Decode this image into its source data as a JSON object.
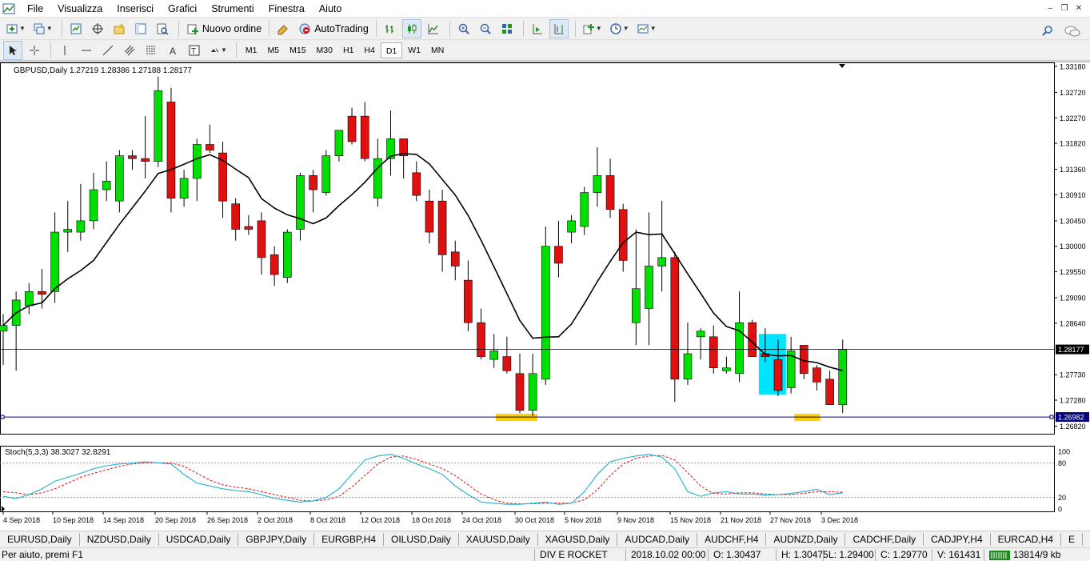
{
  "menu": [
    "File",
    "Visualizza",
    "Inserisci",
    "Grafici",
    "Strumenti",
    "Finestra",
    "Aiuto"
  ],
  "toolbar": {
    "new_order_label": "Nuovo ordine",
    "autotrading_label": "AutoTrading",
    "timeframes": [
      "M1",
      "M5",
      "M15",
      "M30",
      "H1",
      "H4",
      "D1",
      "W1",
      "MN"
    ],
    "active_timeframe": "D1"
  },
  "chart": {
    "header": "GBPUSD,Daily  1.27219 1.28386 1.27188 1.28177",
    "indicator_header": "Stoch(5,3,3) 38.3027 32.8291",
    "current_price": "1.28177",
    "marker_price": "1.26982",
    "colors": {
      "bull": "#00e000",
      "bear": "#e01010",
      "ma": "#000000",
      "stoch_main": "#20b0d0",
      "stoch_signal": "#e01010",
      "highlight_cyan": "#00e5ff",
      "highlight_yellow": "#ffd000",
      "price_label_bg": "#000080"
    }
  },
  "chart_data": {
    "type": "candlestick",
    "symbol": "GBPUSD",
    "timeframe": "Daily",
    "y_ticks": [
      "1.33180",
      "1.32720",
      "1.32270",
      "1.31820",
      "1.31360",
      "1.30910",
      "1.30450",
      "1.30000",
      "1.29550",
      "1.29090",
      "1.28640",
      "1.27730",
      "1.27280",
      "1.26820"
    ],
    "ylim": [
      1.267,
      1.3325
    ],
    "x_labels": [
      "4 Sep 2018",
      "10 Sep 2018",
      "14 Sep 2018",
      "20 Sep 2018",
      "26 Sep 2018",
      "2 Oct 2018",
      "8 Oct 2018",
      "12 Oct 2018",
      "18 Oct 2018",
      "24 Oct 2018",
      "30 Oct 2018",
      "5 Nov 2018",
      "9 Nov 2018",
      "15 Nov 2018",
      "21 Nov 2018",
      "27 Nov 2018",
      "3 Dec 2018"
    ],
    "candles": [
      [
        1.285,
        1.288,
        1.279,
        1.286
      ],
      [
        1.286,
        1.292,
        1.278,
        1.2905
      ],
      [
        1.2895,
        1.2935,
        1.288,
        1.292
      ],
      [
        1.292,
        1.296,
        1.289,
        1.2915
      ],
      [
        1.292,
        1.306,
        1.29,
        1.3025
      ],
      [
        1.3025,
        1.308,
        1.299,
        1.303
      ],
      [
        1.3025,
        1.311,
        1.301,
        1.3045
      ],
      [
        1.3045,
        1.313,
        1.303,
        1.31
      ],
      [
        1.31,
        1.315,
        1.308,
        1.3115
      ],
      [
        1.308,
        1.317,
        1.306,
        1.316
      ],
      [
        1.316,
        1.317,
        1.3135,
        1.3155
      ],
      [
        1.3155,
        1.323,
        1.312,
        1.315
      ],
      [
        1.315,
        1.33,
        1.314,
        1.3275
      ],
      [
        1.3255,
        1.328,
        1.306,
        1.3085
      ],
      [
        1.3085,
        1.3135,
        1.307,
        1.312
      ],
      [
        1.312,
        1.319,
        1.308,
        1.318
      ],
      [
        1.318,
        1.3215,
        1.3165,
        1.317
      ],
      [
        1.3165,
        1.3185,
        1.305,
        1.308
      ],
      [
        1.3075,
        1.3085,
        1.301,
        1.303
      ],
      [
        1.3035,
        1.3055,
        1.302,
        1.303
      ],
      [
        1.3045,
        1.306,
        1.295,
        1.298
      ],
      [
        1.2985,
        1.3,
        1.293,
        1.295
      ],
      [
        1.2945,
        1.303,
        1.2935,
        1.3025
      ],
      [
        1.303,
        1.313,
        1.301,
        1.3125
      ],
      [
        1.3125,
        1.3135,
        1.306,
        1.31
      ],
      [
        1.3095,
        1.317,
        1.309,
        1.316
      ],
      [
        1.316,
        1.32,
        1.315,
        1.3205
      ],
      [
        1.323,
        1.3245,
        1.318,
        1.3185
      ],
      [
        1.323,
        1.3255,
        1.315,
        1.3155
      ],
      [
        1.3085,
        1.319,
        1.307,
        1.3155
      ],
      [
        1.3155,
        1.324,
        1.3125,
        1.319
      ],
      [
        1.319,
        1.3185,
        1.312,
        1.316
      ],
      [
        1.313,
        1.315,
        1.308,
        1.309
      ],
      [
        1.308,
        1.31,
        1.3005,
        1.3025
      ],
      [
        1.308,
        1.31,
        1.2955,
        1.2985
      ],
      [
        1.299,
        1.301,
        1.294,
        1.2965
      ],
      [
        1.294,
        1.2975,
        1.285,
        1.2865
      ],
      [
        1.2865,
        1.289,
        1.28,
        1.2805
      ],
      [
        1.28,
        1.2845,
        1.2785,
        1.2815
      ],
      [
        1.2805,
        1.284,
        1.2775,
        1.278
      ],
      [
        1.2775,
        1.281,
        1.2705,
        1.271
      ],
      [
        1.271,
        1.281,
        1.27,
        1.2775
      ],
      [
        1.2765,
        1.3035,
        1.2755,
        1.3
      ],
      [
        1.3,
        1.3045,
        1.2945,
        1.297
      ],
      [
        1.3025,
        1.3055,
        1.3005,
        1.3045
      ],
      [
        1.3035,
        1.3105,
        1.302,
        1.3095
      ],
      [
        1.3095,
        1.3175,
        1.307,
        1.3125
      ],
      [
        1.3125,
        1.3155,
        1.305,
        1.3065
      ],
      [
        1.3065,
        1.3075,
        1.2955,
        1.2975
      ],
      [
        1.2865,
        1.303,
        1.2825,
        1.2925
      ],
      [
        1.289,
        1.306,
        1.2825,
        1.2965
      ],
      [
        1.2965,
        1.308,
        1.292,
        1.298
      ],
      [
        1.298,
        1.299,
        1.2725,
        1.2765
      ],
      [
        1.2765,
        1.2865,
        1.2755,
        1.281
      ],
      [
        1.284,
        1.2855,
        1.28,
        1.285
      ],
      [
        1.284,
        1.286,
        1.2775,
        1.2785
      ],
      [
        1.278,
        1.2805,
        1.2775,
        1.2785
      ],
      [
        1.2775,
        1.292,
        1.276,
        1.2865
      ],
      [
        1.2865,
        1.287,
        1.281,
        1.2805
      ],
      [
        1.281,
        1.2855,
        1.2795,
        1.2805
      ],
      [
        1.28,
        1.2835,
        1.2735,
        1.2745
      ],
      [
        1.275,
        1.284,
        1.274,
        1.2815
      ],
      [
        1.2825,
        1.2815,
        1.2765,
        1.2775
      ],
      [
        1.2785,
        1.279,
        1.2745,
        1.276
      ],
      [
        1.2765,
        1.278,
        1.2735,
        1.272
      ],
      [
        1.272,
        1.2835,
        1.2705,
        1.2818
      ]
    ],
    "ma_period_label": "",
    "stoch": {
      "k": [
        22,
        18,
        25,
        35,
        48,
        55,
        62,
        70,
        75,
        78,
        80,
        82,
        80,
        78,
        60,
        45,
        40,
        35,
        32,
        30,
        25,
        18,
        15,
        12,
        14,
        20,
        35,
        60,
        85,
        92,
        95,
        88,
        78,
        70,
        60,
        40,
        25,
        12,
        10,
        8,
        8,
        10,
        12,
        8,
        10,
        30,
        60,
        82,
        88,
        92,
        95,
        90,
        70,
        30,
        22,
        28,
        30,
        26,
        26,
        24,
        25,
        27,
        30,
        34,
        25,
        28
      ],
      "d": [
        30,
        28,
        25,
        28,
        35,
        45,
        55,
        62,
        68,
        74,
        78,
        80,
        80,
        80,
        74,
        62,
        50,
        42,
        38,
        35,
        30,
        25,
        20,
        15,
        14,
        16,
        22,
        38,
        58,
        78,
        90,
        92,
        86,
        78,
        70,
        58,
        42,
        26,
        16,
        10,
        9,
        9,
        10,
        10,
        10,
        16,
        33,
        58,
        78,
        88,
        92,
        93,
        85,
        63,
        40,
        27,
        26,
        28,
        28,
        26,
        25,
        25,
        27,
        30,
        30,
        29
      ],
      "levels": [
        "100",
        "80",
        "20",
        "0"
      ]
    }
  },
  "tabs": [
    "EURUSD,Daily",
    "NZDUSD,Daily",
    "USDCAD,Daily",
    "GBPJPY,Daily",
    "EURGBP,H4",
    "OILUSD,Daily",
    "XAUUSD,Daily",
    "XAGUSD,Daily",
    "AUDCAD,Daily",
    "AUDCHF,H4",
    "AUDNZD,Daily",
    "CADCHF,Daily",
    "CADJPY,H4",
    "EURCAD,H4",
    "E"
  ],
  "status": {
    "help": "Per aiuto, premi F1",
    "profile": "DIV E ROCKET",
    "datetime": "2018.10.02 00:00",
    "open": "O: 1.30437",
    "high": "H: 1.30475",
    "low": "L: 1.29400",
    "close": "C: 1.29770",
    "volume": "V: 161431",
    "traffic": "13814/9 kb"
  }
}
